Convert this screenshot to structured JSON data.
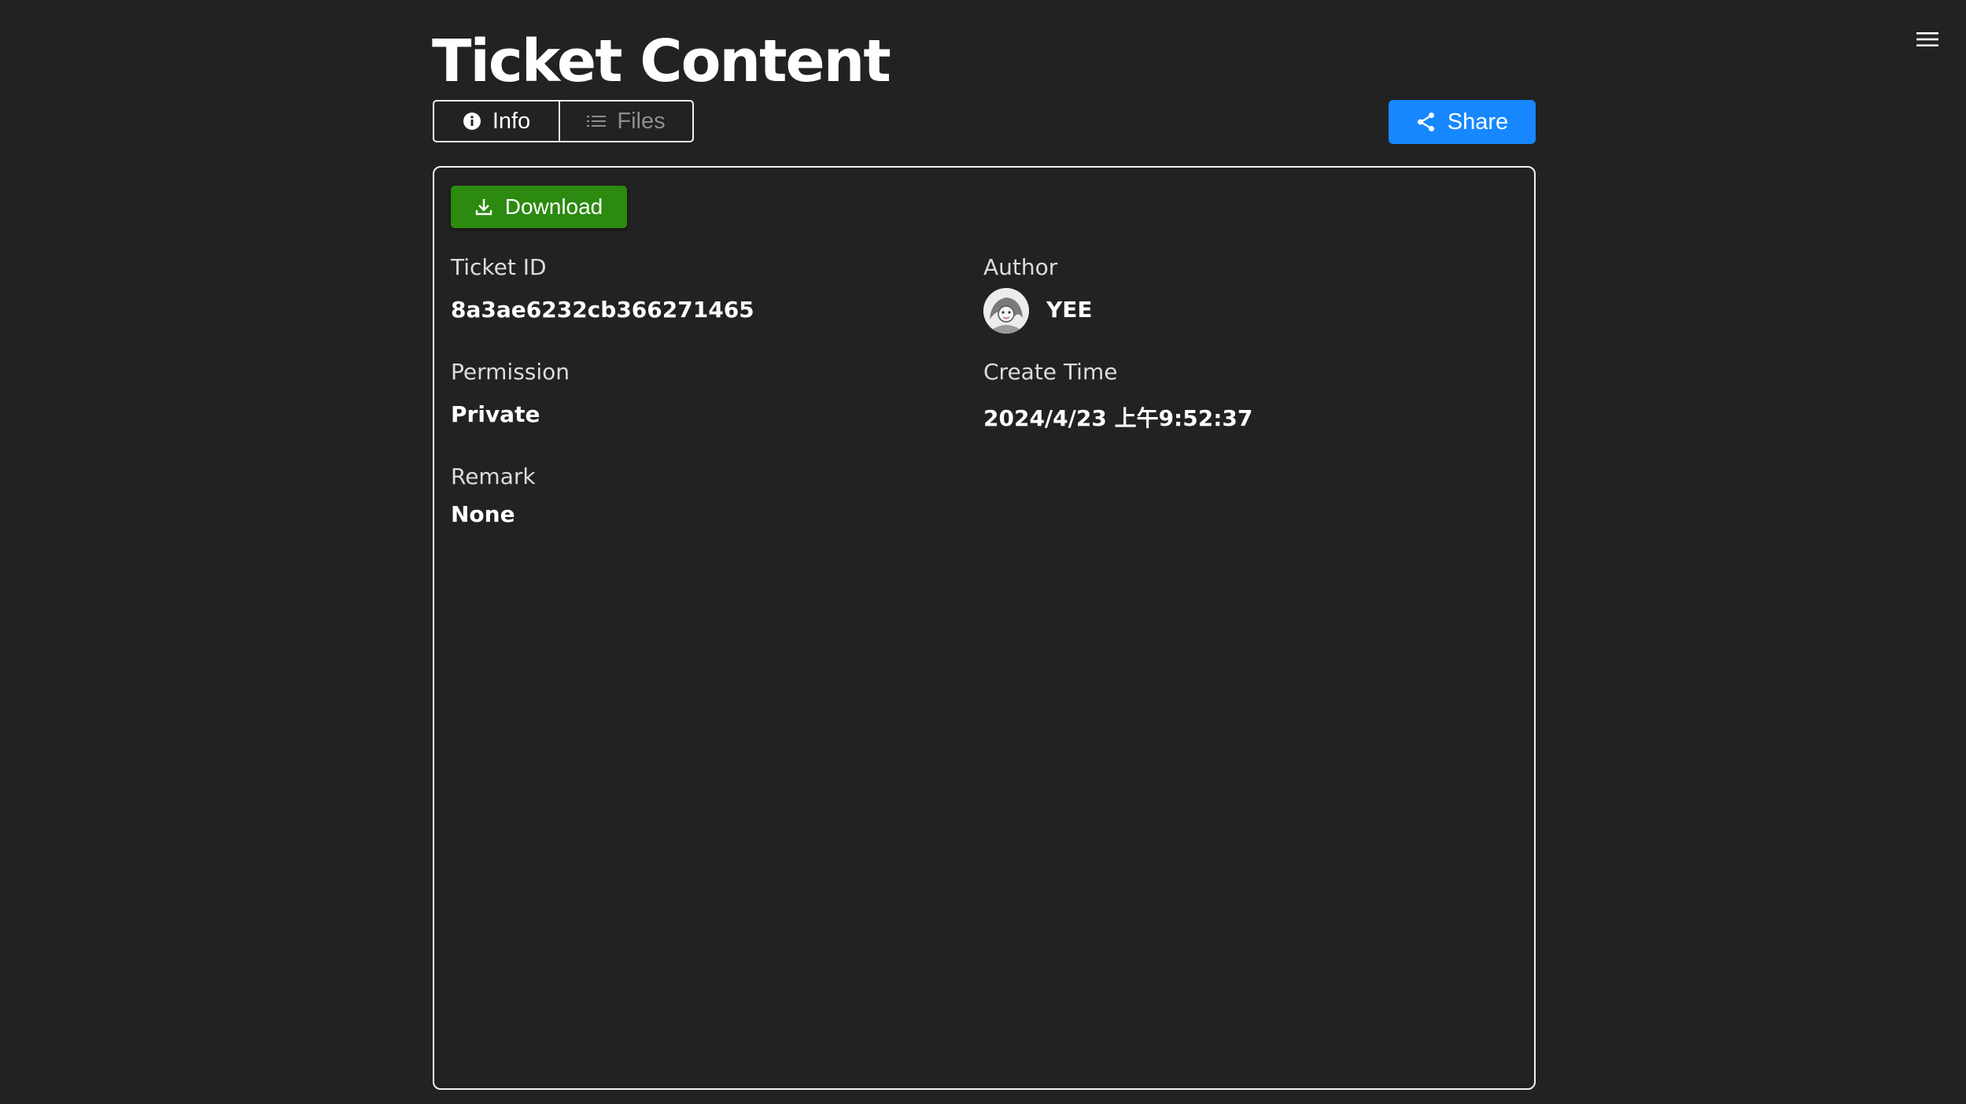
{
  "header": {
    "title": "Ticket Content",
    "menu_icon": "hamburger-menu-icon"
  },
  "tabs": [
    {
      "label": "Info",
      "icon": "info-circle-icon",
      "active": true
    },
    {
      "label": "Files",
      "icon": "list-icon",
      "active": false
    }
  ],
  "share": {
    "label": "Share",
    "icon": "share-icon",
    "color": "#1687ff"
  },
  "ticket": {
    "download_label": "Download",
    "download_icon": "download-icon",
    "download_color": "#2b8a0f",
    "fields": {
      "ticket_id": {
        "label": "Ticket ID",
        "value": "8a3ae6232cb366271465"
      },
      "author": {
        "label": "Author",
        "value": "YEE"
      },
      "permission": {
        "label": "Permission",
        "value": "Private"
      },
      "create_time": {
        "label": "Create Time",
        "value": "2024/4/23 上午9:52:37"
      },
      "remark": {
        "label": "Remark",
        "value": "None"
      }
    }
  },
  "colors": {
    "background": "#222222",
    "border": "#f2f2f2",
    "text": "#ffffff",
    "muted_text": "#8e8e8e"
  }
}
